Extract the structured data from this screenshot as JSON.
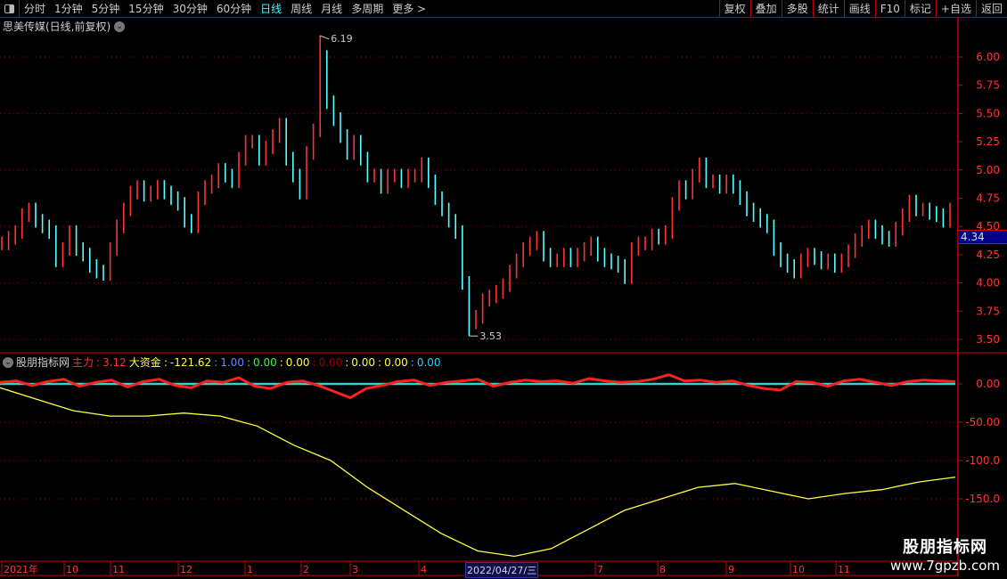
{
  "toolbar": {
    "periods": [
      "分时",
      "1分钟",
      "5分钟",
      "15分钟",
      "30分钟",
      "60分钟",
      "日线",
      "周线",
      "月线",
      "多周期",
      "更多 >"
    ],
    "active": "日线",
    "right_buttons": [
      "复权",
      "叠加",
      "多股",
      "统计",
      "画线",
      "F10",
      "标记",
      "+自选",
      "返回"
    ]
  },
  "title": "思美传媒(日线,前复权)",
  "price_axis": [
    "6.00",
    "5.75",
    "5.50",
    "5.25",
    "5.00",
    "4.75",
    "4.50",
    "4.25",
    "4.00",
    "3.75",
    "3.50"
  ],
  "current_price": "4.34",
  "max_label": "6.19",
  "min_label": "3.53",
  "indicator": {
    "name": "股朋指标网",
    "legend": [
      {
        "k": "主力",
        "v": "3.12",
        "color": "#ff3030"
      },
      {
        "k": "大资金",
        "v": "-121.62",
        "color": "#ffff40"
      },
      {
        "k": "",
        "v": "1.00",
        "color": "#6688ff"
      },
      {
        "k": "",
        "v": "0.00",
        "color": "#30ff30"
      },
      {
        "k": "",
        "v": "0.00",
        "color": "#ffff40"
      },
      {
        "k": "",
        "v": "0.00",
        "color": "#a00000"
      },
      {
        "k": "",
        "v": "0.00",
        "color": "#ffff40"
      },
      {
        "k": "",
        "v": "0.00",
        "color": "#ffff40"
      },
      {
        "k": "",
        "v": "0.00",
        "color": "#30d0ff"
      }
    ],
    "axis": [
      "0.00",
      "-50.00",
      "-100.0",
      "-150.0"
    ]
  },
  "time_axis": [
    "2021年",
    "10",
    "11",
    "12",
    "1",
    "2",
    "3",
    "4",
    "7",
    "8",
    "9",
    "10",
    "11"
  ],
  "selected_date": "2022/04/27/三",
  "watermark": {
    "line1": "股朋指标网",
    "line2": "www.7gpzb.com"
  },
  "chart_data": [
    {
      "type": "candlestick",
      "ylim": [
        3.5,
        6.2
      ],
      "high": 6.19,
      "low": 3.53,
      "closes": [
        4.35,
        4.4,
        4.45,
        4.6,
        4.65,
        4.55,
        4.5,
        4.45,
        4.2,
        4.3,
        4.45,
        4.3,
        4.25,
        4.15,
        4.1,
        4.08,
        4.3,
        4.5,
        4.65,
        4.8,
        4.85,
        4.78,
        4.8,
        4.85,
        4.8,
        4.75,
        4.7,
        4.55,
        4.5,
        4.75,
        4.85,
        4.9,
        5.0,
        4.95,
        4.9,
        5.1,
        5.25,
        5.25,
        5.1,
        5.2,
        5.3,
        5.4,
        5.1,
        4.95,
        4.8,
        5.15,
        5.35,
        6.0,
        5.6,
        5.45,
        5.3,
        5.15,
        5.25,
        5.1,
        4.95,
        4.95,
        4.85,
        4.95,
        4.95,
        4.9,
        4.95,
        4.95,
        5.05,
        4.9,
        4.75,
        4.65,
        4.55,
        4.45,
        4.0,
        3.65,
        3.7,
        3.85,
        3.88,
        3.92,
        3.98,
        4.1,
        4.2,
        4.3,
        4.35,
        4.4,
        4.25,
        4.2,
        4.2,
        4.25,
        4.2,
        4.25,
        4.3,
        4.35,
        4.25,
        4.2,
        4.18,
        4.15,
        4.05,
        4.3,
        4.35,
        4.35,
        4.42,
        4.4,
        4.45,
        4.7,
        4.85,
        4.8,
        4.95,
        5.05,
        4.9,
        4.9,
        4.85,
        4.9,
        4.85,
        4.75,
        4.65,
        4.6,
        4.55,
        4.5,
        4.3,
        4.2,
        4.15,
        4.1,
        4.2,
        4.25,
        4.22,
        4.18,
        4.2,
        4.15,
        4.2,
        4.28,
        4.38,
        4.45,
        4.5,
        4.45,
        4.4,
        4.38,
        4.48,
        4.6,
        4.72,
        4.65,
        4.65,
        4.62,
        4.6,
        4.55,
        4.65
      ]
    },
    {
      "type": "line",
      "ylim": [
        -230,
        20
      ],
      "series": [
        {
          "name": "大资金",
          "color": "#ffff40",
          "values": [
            -5,
            -20,
            -35,
            -42,
            -42,
            -38,
            -42,
            -55,
            -80,
            -100,
            -135,
            -165,
            -195,
            -218,
            -225,
            -215,
            -190,
            -165,
            -150,
            -135,
            -130,
            -140,
            -150,
            -143,
            -138,
            -128,
            -121.62
          ]
        },
        {
          "name": "主力",
          "color": "#ff2020",
          "values": [
            2,
            4,
            -2,
            3,
            6,
            -3,
            2,
            5,
            -4,
            3,
            6,
            -2,
            -5,
            4,
            2,
            8,
            -3,
            -6,
            2,
            4,
            -2,
            -10,
            -18,
            -6,
            -2,
            3,
            5,
            -2,
            2,
            4,
            6,
            -3,
            2,
            5,
            3,
            4,
            1,
            7,
            4,
            2,
            3,
            6,
            12,
            4,
            5,
            2,
            4,
            -2,
            -6,
            -8,
            3,
            2,
            -3,
            4,
            6,
            2,
            -2,
            3,
            5,
            4,
            3
          ]
        },
        {
          "color": "#30d0d0",
          "values": [
            0,
            0
          ]
        }
      ]
    }
  ]
}
